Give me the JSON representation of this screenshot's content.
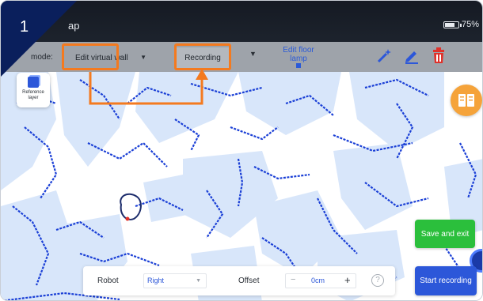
{
  "step_badge": "1",
  "app_title": "ap",
  "status": {
    "battery": "75%"
  },
  "toolbar": {
    "mode_label": "mode:",
    "mode_value": "Edit virtual wall",
    "recording_button": "Recording",
    "edit_lamp_label": "Edit floor lamp"
  },
  "reference_layer": {
    "label": "Reference layer"
  },
  "actions": {
    "save_exit": "Save and exit",
    "start_recording": "Start recording"
  },
  "bottom_panel": {
    "robot_label": "Robot",
    "robot_value": "Right",
    "offset_label": "Offset",
    "offset_minus": "−",
    "offset_value": "0cm",
    "offset_plus": "+",
    "help": "?"
  },
  "colors": {
    "highlight": "#f47a1f",
    "accent_blue": "#2c57d9",
    "save_green": "#2bbf3c",
    "book_orange": "#f5a33a",
    "delete_red": "#e0312a"
  },
  "icons": [
    "battery-icon",
    "chevron-down-icon",
    "lamp-icon",
    "magic-wand-icon",
    "pencil-icon",
    "trash-icon",
    "cube-icon",
    "book-icon",
    "help-icon"
  ]
}
